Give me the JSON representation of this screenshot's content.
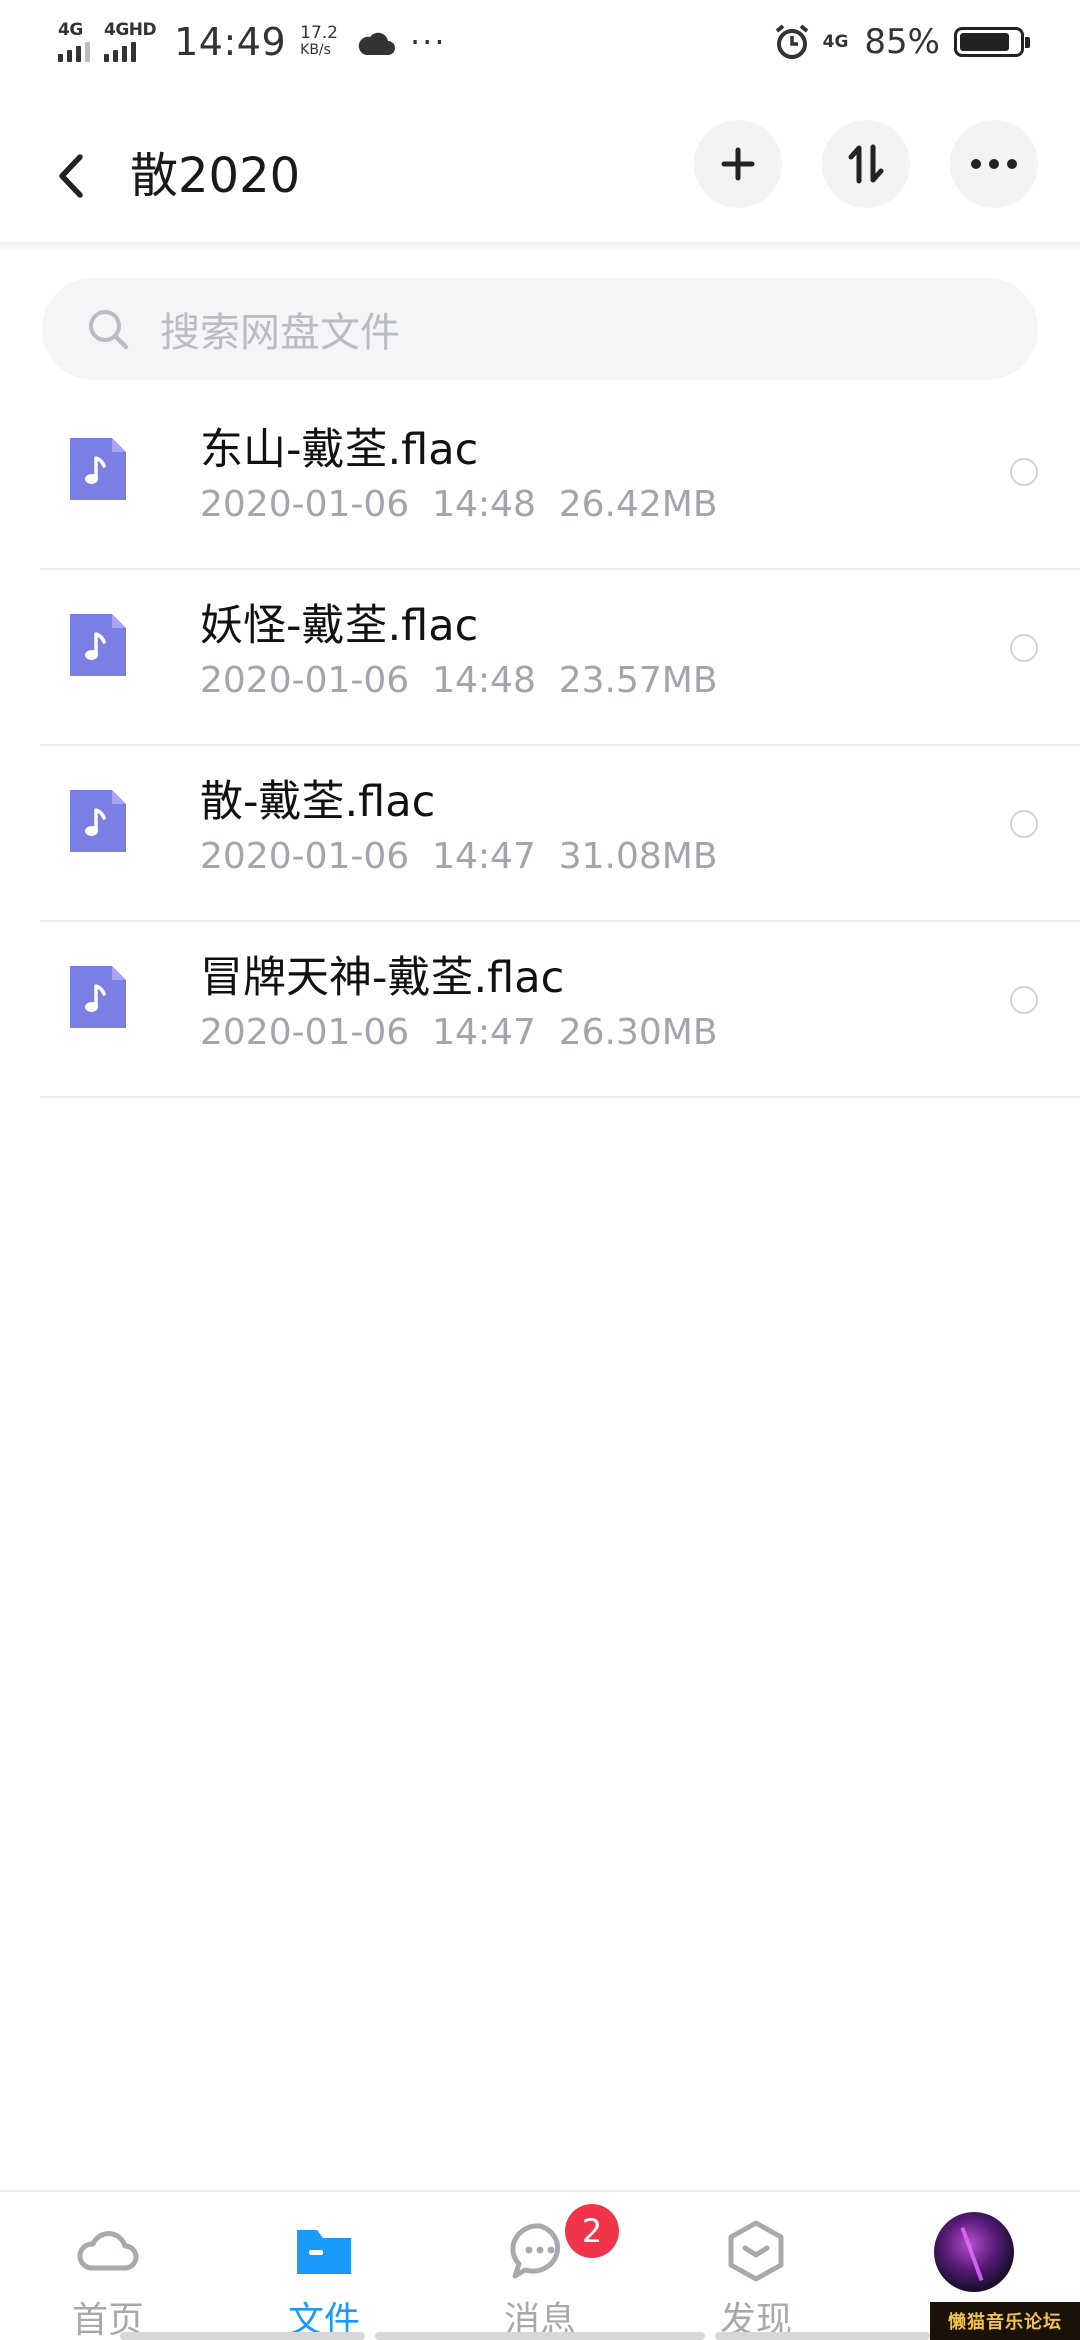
{
  "status_bar": {
    "network_1": "4G",
    "network_2": "4GHD",
    "time": "14:49",
    "speed_value": "17.2",
    "speed_unit": "KB/s",
    "more_dots": "···",
    "network_3": "4G",
    "battery_percent": "85%",
    "battery_level": 0.85
  },
  "header": {
    "title": "散2020",
    "icons": {
      "back": "back-chevron-icon",
      "add": "plus-icon",
      "sort": "sort-arrows-icon",
      "more": "more-dots-icon"
    }
  },
  "search": {
    "placeholder": "搜索网盘文件",
    "icon": "search-icon"
  },
  "files": [
    {
      "name": "东山-戴荃.flac",
      "meta": "2020-01-06  14:48  26.42MB"
    },
    {
      "name": "妖怪-戴荃.flac",
      "meta": "2020-01-06  14:48  23.57MB"
    },
    {
      "name": "散-戴荃.flac",
      "meta": "2020-01-06  14:47  31.08MB"
    },
    {
      "name": "冒牌天神-戴荃.flac",
      "meta": "2020-01-06  14:47  26.30MB"
    }
  ],
  "bottom_nav": {
    "items": [
      {
        "label": "首页",
        "icon": "cloud-icon"
      },
      {
        "label": "文件",
        "icon": "folder-icon",
        "active": true
      },
      {
        "label": "消息",
        "icon": "chat-bubble-icon",
        "badge": "2"
      },
      {
        "label": "发现",
        "icon": "hexagon-icon"
      },
      {
        "label": "",
        "icon": "avatar"
      }
    ]
  },
  "watermark": "懒猫音乐论坛",
  "colors": {
    "accent": "#1a9bfc",
    "file_icon": "#7b7fe3",
    "badge": "#f0354a",
    "meta_text": "#a2a5ab"
  }
}
